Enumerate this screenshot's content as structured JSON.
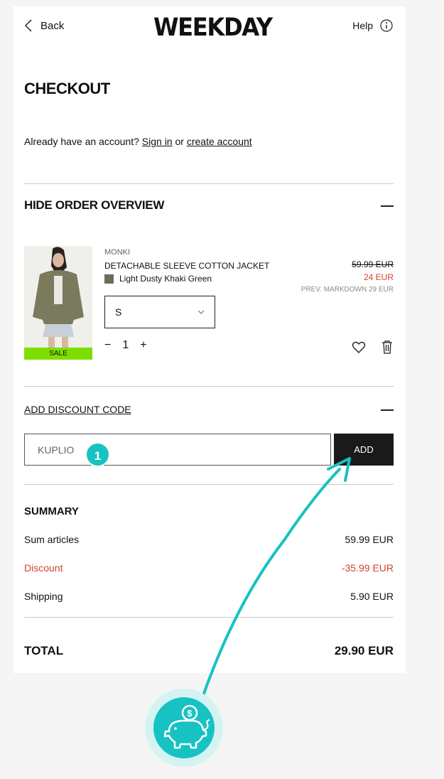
{
  "header": {
    "back_label": "Back",
    "logo": "WEEKDAY",
    "help_label": "Help"
  },
  "page_title": "CHECKOUT",
  "account": {
    "prompt": "Already have an account?",
    "sign_in": "Sign in",
    "or": "or",
    "create": "create account"
  },
  "order_overview": {
    "title": "HIDE ORDER OVERVIEW"
  },
  "product": {
    "brand": "MONKI",
    "name": "DETACHABLE SLEEVE COTTON JACKET",
    "color_name": "Light Dusty Khaki Green",
    "swatch_color": "#6f6b59",
    "price_old": "59.99 EUR",
    "price_new": "24 EUR",
    "prev_markdown": "PREV. MARKDOWN 29 EUR",
    "badge": "SALE",
    "size": "S",
    "qty_minus": "−",
    "quantity": "1",
    "qty_plus": "+"
  },
  "discount": {
    "title": "ADD DISCOUNT CODE",
    "code_value": "KUPLIO",
    "add_label": "ADD",
    "step_number": "1"
  },
  "summary": {
    "title": "SUMMARY",
    "rows": [
      {
        "label": "Sum articles",
        "value": "59.99 EUR"
      },
      {
        "label": "Discount",
        "value": "-35.99 EUR"
      },
      {
        "label": "Shipping",
        "value": "5.90 EUR"
      }
    ],
    "total_label": "TOTAL",
    "total_value": "29.90 EUR"
  },
  "colors": {
    "accent": "#17c2c2",
    "sale_green": "#7ddf00",
    "discount_red": "#d0452c"
  },
  "icons": [
    "chevron-left-icon",
    "info-icon",
    "chevron-down-icon",
    "heart-icon",
    "trash-icon",
    "piggy-bank-icon",
    "coin-icon"
  ]
}
